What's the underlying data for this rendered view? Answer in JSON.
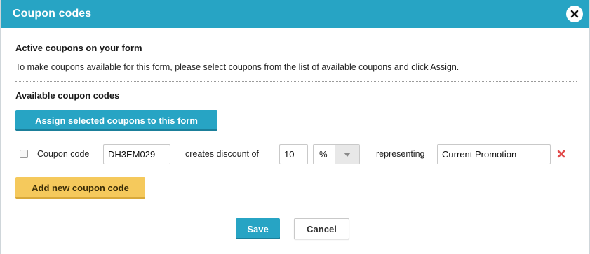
{
  "dialog": {
    "title": "Coupon codes",
    "close_icon": "close-icon"
  },
  "active_section": {
    "heading": "Active coupons on your form",
    "description": "To make coupons available for this form, please select coupons from the list of available coupons and click Assign."
  },
  "available_section": {
    "heading": "Available coupon codes",
    "assign_button": "Assign selected coupons to this form"
  },
  "coupon_row": {
    "checked": false,
    "code_label": "Coupon code",
    "code_value": "DH3EM029",
    "creates_label": "creates discount of",
    "discount_value": "10",
    "discount_unit": "%",
    "representing_label": "representing",
    "representing_value": "Current Promotion",
    "delete_icon": "delete-x-icon"
  },
  "add_button": "Add new coupon code",
  "footer": {
    "save_label": "Save",
    "cancel_label": "Cancel"
  },
  "colors": {
    "primary": "#27a4c4",
    "add_button": "#f5c95c",
    "delete": "#e24b4b"
  }
}
